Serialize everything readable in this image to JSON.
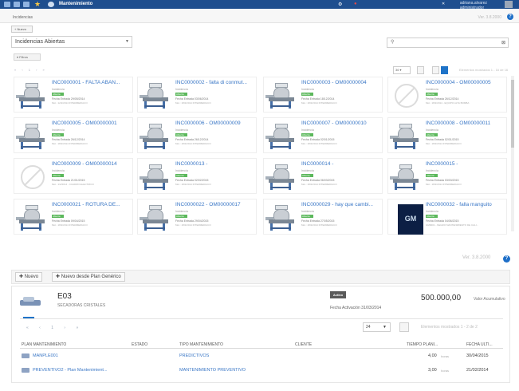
{
  "topbar": {
    "app_title": "Mantenimiento",
    "user": "adriana.alvarez",
    "user_sub": "administrador"
  },
  "subbar": {
    "breadcrumb": "Incidencias",
    "version": "Ver. 3.8.2000"
  },
  "toolbar": {
    "new_small": "+ Nuevo"
  },
  "view_select": {
    "value": "Incidencias Abiertas"
  },
  "search": {
    "placeholder": ""
  },
  "filter_btn": "▾ Filtros",
  "list_pager": {
    "page_size": "36 ▾",
    "count": "Elementos mostrados 1 - 16 de 16",
    "nav": "« ‹ 1 › »"
  },
  "cards": [
    {
      "title": "INC0000001 - FALTA ABAN...",
      "sub": "Incidencia",
      "badge": "Abierta",
      "date": "Fecha Entrada 29/05/2014",
      "meta": "Mot.: 12/2/2014 INTERMEDIACO",
      "img": "machine"
    },
    {
      "title": "INC0000002 - falta di conmut...",
      "sub": "Incidencia",
      "badge": "Abierta",
      "date": "Fecha Entrada 03/06/2014",
      "meta": "Mot.: 18/2/2014 INTERMEDIACO",
      "img": "machine"
    },
    {
      "title": "INC0000003 - OM00000004",
      "sub": "Incidencia",
      "badge": "Abierta",
      "date": "Fecha Entrada 18/12/2014",
      "meta": "Mot.: 18/2/2014 INTERMEDIACO",
      "img": "machine"
    },
    {
      "title": "INC0000004 - OM00000005",
      "sub": "Incidencia",
      "badge": "Abierta",
      "date": "Fecha Entrada 26/12/2014",
      "meta": "Mot.: 18/2/2014 - EQUIPO ALTA BOMBA",
      "img": "none"
    },
    {
      "title": "INC0000005 - OM00000001",
      "sub": "Incidencia",
      "badge": "Abierta",
      "date": "Fecha Entrada 26/12/2014",
      "meta": "Mot.: 18/2/2014 INTERMEDIACO",
      "img": "machine"
    },
    {
      "title": "INC0000006 - OM00000009",
      "sub": "Incidencia",
      "badge": "Abierta",
      "date": "Fecha Entrada 26/12/2014",
      "meta": "Mot.: 18/2/2014 INTERMEDIACO",
      "img": "machine"
    },
    {
      "title": "INC0000007 - OM00000010",
      "sub": "Incidencia",
      "badge": "Abierta",
      "date": "Fecha Entrada 02/01/2015",
      "meta": "Mot.: 18/2/2014 INTERMEDIACO",
      "img": "machine"
    },
    {
      "title": "INC0000008 - OM00000011",
      "sub": "Incidencia",
      "badge": "Abierta",
      "date": "Fecha Entrada 02/01/2015",
      "meta": "Mot.: 18/2/2014 INTERMEDIACO",
      "img": "machine"
    },
    {
      "title": "INC0000009 - OM00000014",
      "sub": "Incidencia",
      "badge": "Abierta",
      "date": "Fecha Entrada 21/01/2015",
      "meta": "Mot.: 1/2/2014 - CUADRO ELECTRICO",
      "img": "none"
    },
    {
      "title": "INC0000013 -",
      "sub": "Incidencia",
      "badge": "Abierta",
      "date": "Fecha Entrada 02/02/2015",
      "meta": "Mot.: 18/2/2014 INTERMEDIACO",
      "img": "machine"
    },
    {
      "title": "INC0000014 -",
      "sub": "Incidencia",
      "badge": "Abierta",
      "date": "Fecha Entrada 06/03/2015",
      "meta": "Mot.: 18/2/2014 INTERMEDIACO",
      "img": "machine"
    },
    {
      "title": "INC0000015 -",
      "sub": "Incidencia",
      "badge": "Abierta",
      "date": "Fecha Entrada 03/03/2015",
      "meta": "Mot.: 18/2/2014 INTERMEDIACO",
      "img": "machine"
    },
    {
      "title": "INC0000021 - ROTURA DE...",
      "sub": "Incidencia",
      "badge": "Abierta",
      "date": "Fecha Entrada 09/04/2015",
      "meta": "Mot.: 18/2/2014 INTERMEDIACO",
      "img": "machine"
    },
    {
      "title": "INC0000022 - OM00000017",
      "sub": "Incidencia",
      "badge": "Abierta",
      "date": "Fecha Entrada 29/04/2015",
      "meta": "Mot.: 18/2/2014 INTERMEDIACO",
      "img": "machine"
    },
    {
      "title": "INC0000029 - hay que cambi...",
      "sub": "Incidencia",
      "badge": "Abierta",
      "date": "Fecha Entrada 27/05/2015",
      "meta": "Mot.: 18/2/2014 INTERMEDIACO",
      "img": "machine"
    },
    {
      "title": "INC0000032 - falla manguito",
      "sub": "Incidencia",
      "badge": "Abierta",
      "date": "Fecha Entrada 04/06/2015",
      "meta": "GM0001 - NEGRO MANTENIMIENTO DE CALI...",
      "img": "gm"
    }
  ],
  "bottom": {
    "version": "Ver. 3.8.2000",
    "new_btn": "Nuevo",
    "new_plan_btn": "Nuevo desde Plan Genérico",
    "code": "E03",
    "description": "SECADORAS CRISTALES",
    "status_badge": "Activo",
    "activation": "Fecha Activación 31/03/2014",
    "amount": "500.000,00",
    "amount_label": "Valor Acumulativo",
    "page_size": "24",
    "count": "Elementos mostrados 1 - 2 de 2",
    "nav": "« ‹ 1 › »",
    "columns": [
      "PLAN MANTENIMIENTO",
      "ESTADO",
      "TIPO MANTENIMIENTO",
      "CLIENTE",
      "TIEMPO PLANI...",
      "FECHA ULTI..."
    ],
    "rows": [
      {
        "plan": "MANPLE001",
        "estado": "",
        "tipo": "PREDICTIVOS",
        "cliente": "",
        "tiempo": "4,00",
        "unit": "horas",
        "fecha": "30/04/2015"
      },
      {
        "plan": "PREVENTIVO2 - Plan Mantenimient...",
        "estado": "",
        "tipo": "MANTENIMIENTO PREVENTIVO",
        "cliente": "",
        "tiempo": "3,00",
        "unit": "horas",
        "fecha": "21/02/2014"
      }
    ]
  }
}
